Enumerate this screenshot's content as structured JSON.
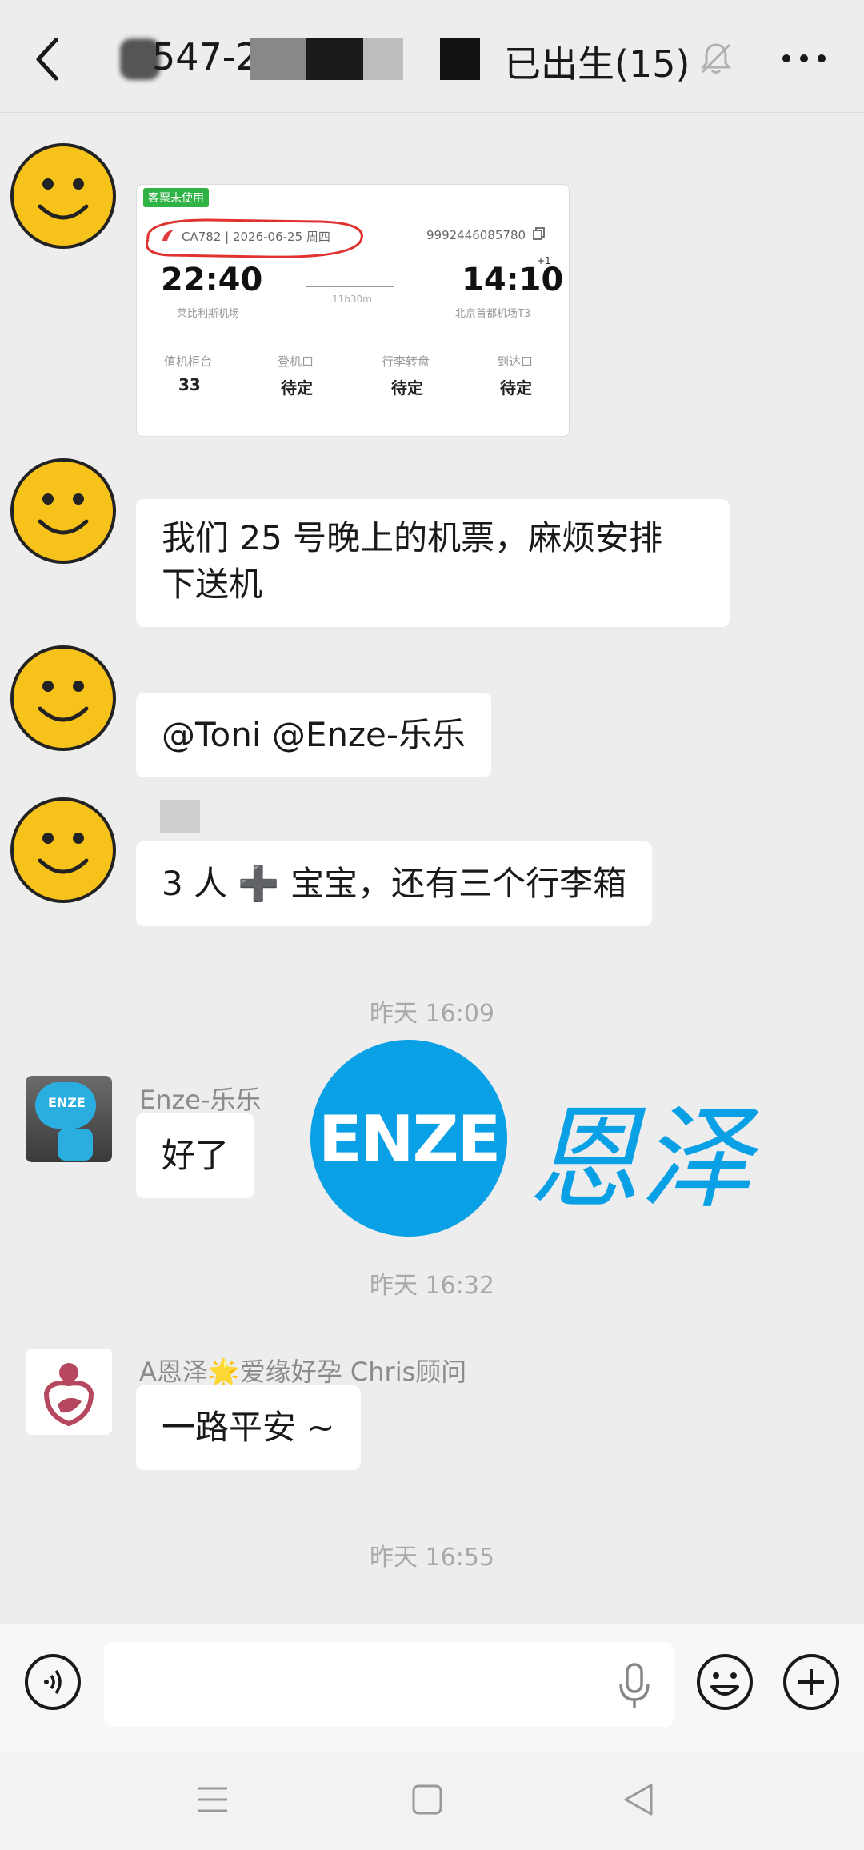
{
  "header": {
    "title_prefix": "547-2",
    "title_suffix": "已出生(15)"
  },
  "ticket": {
    "tag": "客票未使用",
    "flight": "CA782 | 2026-06-25 周四",
    "ticket_no": "9992446085780",
    "dep_time": "22:40",
    "arr_time": "14:10",
    "plus_day": "+1",
    "dep_airport": "莱比利斯机场",
    "arr_airport": "北京首都机场T3",
    "duration": "11h30m",
    "fields": [
      {
        "label": "值机柜台",
        "value": "33"
      },
      {
        "label": "登机口",
        "value": "待定"
      },
      {
        "label": "行李转盘",
        "value": "待定"
      },
      {
        "label": "到达口",
        "value": "待定"
      }
    ]
  },
  "messages": {
    "m2": "我们 25 号晚上的机票，麻烦安排下送机",
    "m2_line1": "我们 25 号晚上的机票，麻烦安排",
    "m2_line2": "下送机",
    "m3": "@Toni @Enze-乐乐",
    "m4": "3 人 ➕ 宝宝，还有三个行李箱",
    "time1": "昨天 16:09",
    "enze_sender": "Enze-乐乐",
    "enze_msg": "好了",
    "enze_avatar_text": "ENZE",
    "time2": "昨天 16:32",
    "chris_sender": "A恩泽🌟爱缘好孕 Chris顾问",
    "chris_msg": "一路平安 ~",
    "time3": "昨天 16:55"
  },
  "watermark": {
    "logo_text": "ENZE",
    "cn_text": "恩泽",
    "brand_color": "#0aa0e6"
  },
  "input": {
    "placeholder": ""
  },
  "icons": [
    "back-arrow-icon",
    "mute-bell-icon",
    "more-dots-icon",
    "voice-icon",
    "mic-icon",
    "emoji-icon",
    "plus-icon",
    "menu-nav-icon",
    "home-nav-icon",
    "back-nav-icon"
  ]
}
